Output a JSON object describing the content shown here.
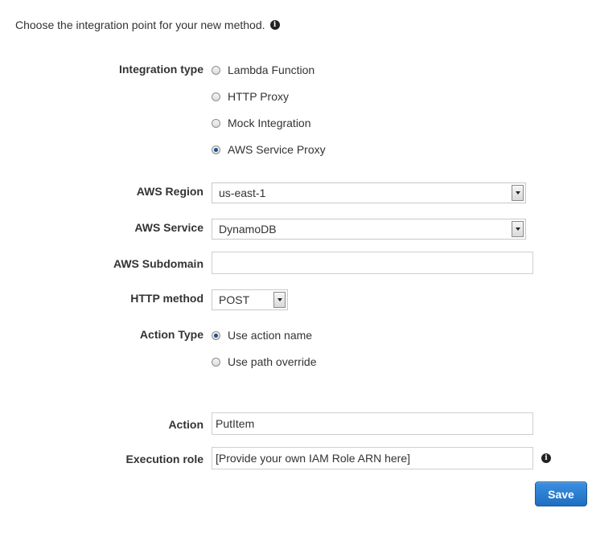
{
  "intro_text": "Choose the integration point for your new method.",
  "integration_type": {
    "label": "Integration type",
    "options": [
      {
        "label": "Lambda Function",
        "checked": false
      },
      {
        "label": "HTTP Proxy",
        "checked": false
      },
      {
        "label": "Mock Integration",
        "checked": false
      },
      {
        "label": "AWS Service Proxy",
        "checked": true
      }
    ]
  },
  "aws_region": {
    "label": "AWS Region",
    "value": "us-east-1"
  },
  "aws_service": {
    "label": "AWS Service",
    "value": "DynamoDB"
  },
  "aws_subdomain": {
    "label": "AWS Subdomain",
    "value": ""
  },
  "http_method": {
    "label": "HTTP method",
    "value": "POST"
  },
  "action_type": {
    "label": "Action Type",
    "options": [
      {
        "label": "Use action name",
        "checked": true
      },
      {
        "label": "Use path override",
        "checked": false
      }
    ]
  },
  "action": {
    "label": "Action",
    "value": "PutItem"
  },
  "execution_role": {
    "label": "Execution role",
    "value": "[Provide your own IAM Role ARN here]"
  },
  "save_button": {
    "label": "Save"
  },
  "colors": {
    "primary_button": "#2b7fd6",
    "radio_checked": "#1e4f8a",
    "text": "#333333"
  },
  "icons": {
    "info": "info-icon",
    "dropdown": "chevron-down-icon"
  }
}
